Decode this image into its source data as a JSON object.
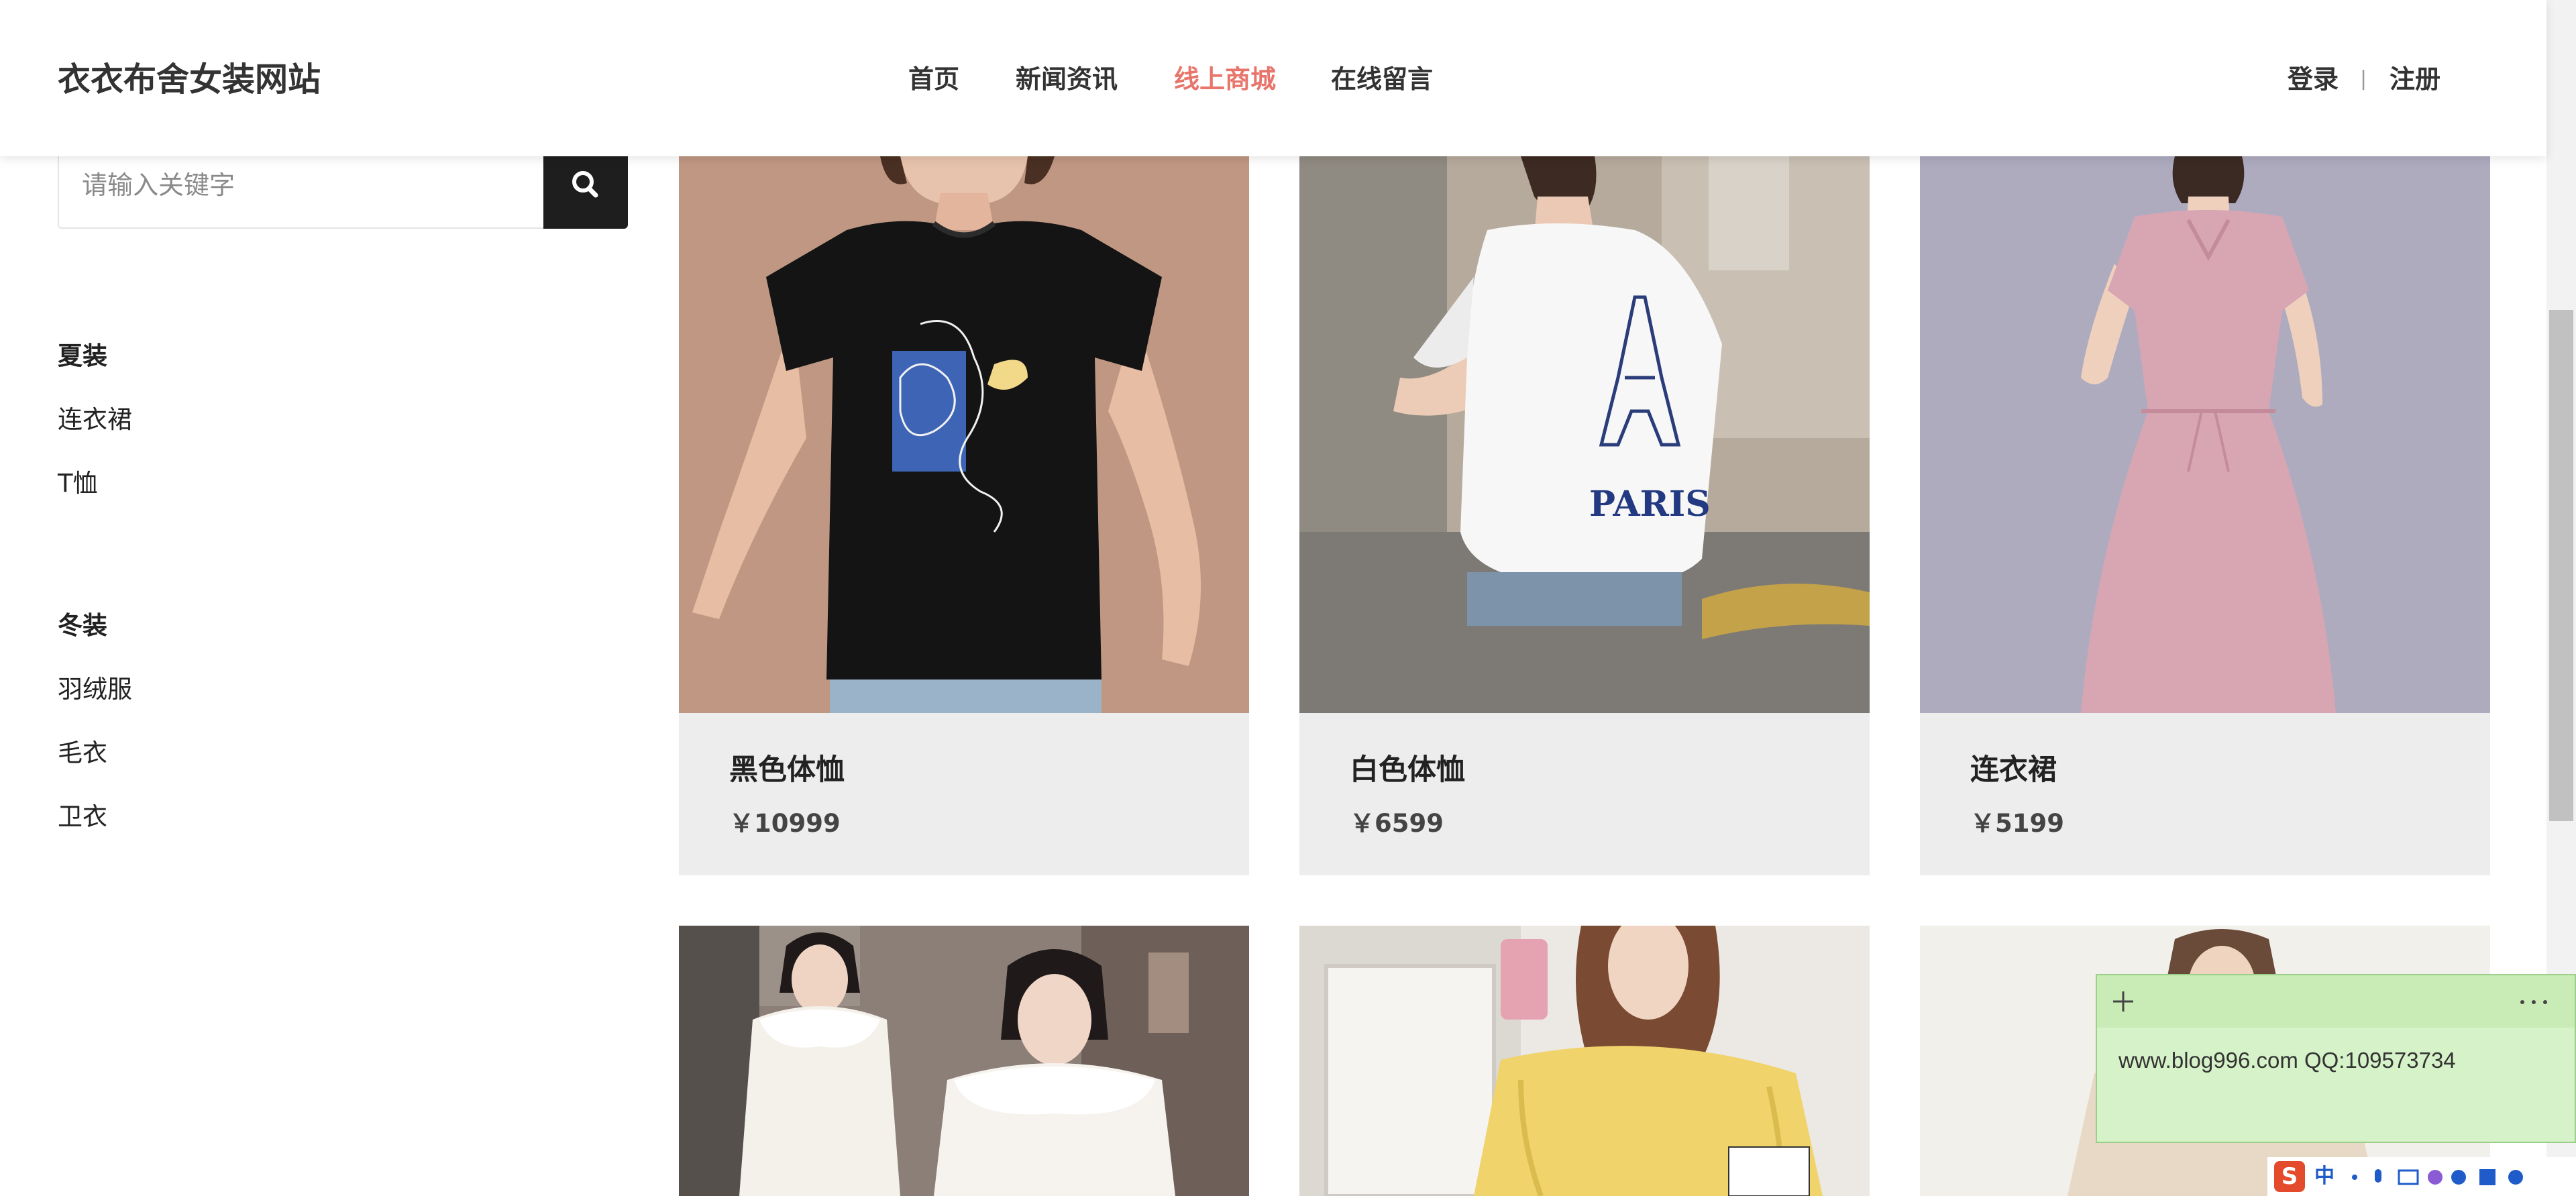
{
  "header": {
    "brand": "衣衣布舍女装网站",
    "nav": [
      {
        "label": "首页",
        "active": false
      },
      {
        "label": "新闻资讯",
        "active": false
      },
      {
        "label": "线上商城",
        "active": true
      },
      {
        "label": "在线留言",
        "active": false
      }
    ],
    "login": "登录",
    "separator": "|",
    "register": "注册",
    "active_color": "#e8756b"
  },
  "search": {
    "placeholder": "请输入关键字",
    "button_icon": "search-icon"
  },
  "sidebar": {
    "groups": [
      {
        "title": "夏装",
        "items": [
          "连衣裙",
          "T恤"
        ]
      },
      {
        "title": "冬装",
        "items": [
          "羽绒服",
          "毛衣",
          "卫衣"
        ]
      }
    ]
  },
  "products": [
    {
      "name": "黑色体恤",
      "price": "￥10999"
    },
    {
      "name": "白色体恤",
      "price": "￥6599"
    },
    {
      "name": "连衣裙",
      "price": "￥5199"
    }
  ],
  "product_images_row2": [
    "white-down-jacket-photo",
    "yellow-sweater-photo",
    "beige-sweater-photo"
  ],
  "sticky_note": {
    "text": "www.blog996.com      QQ:109573734",
    "add_icon": "plus-icon",
    "menu_icon": "more-icon",
    "color": "#d6f2c8"
  },
  "tray": {
    "ime_label": "中",
    "ime_logo": "S"
  },
  "paris_print": "PARIS"
}
